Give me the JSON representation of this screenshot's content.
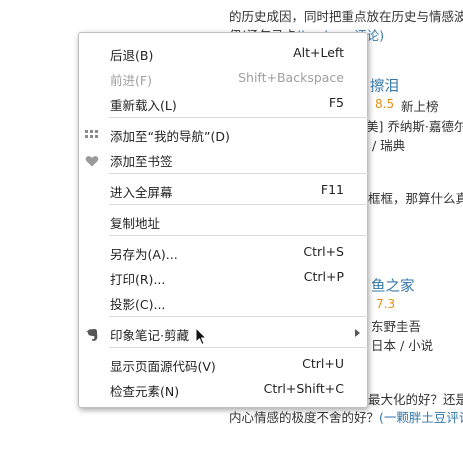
{
  "background": {
    "line1": "的历史成因，同时把重点放在历史与情感波涛",
    "line2_prefix": "伊(汤包马卡",
    "line2_link": "(bookyue评论)",
    "item1_title": "擦泪",
    "item1_rating": "8.5",
    "item1_rank": "新上榜",
    "item1_author": "美] 乔纳斯·嘉德尔",
    "item1_origin": "/ 瑞典",
    "snippet_mid": "框框，那算什么真爱",
    "item2_title": "鱼之家",
    "item2_rating": "7.3",
    "item2_author": "东野圭吾",
    "item2_origin": "日本 / 小说",
    "bottom1": "最大化的好？还是",
    "bottom2_prefix": "内心情感的极度不舍的好？",
    "bottom2_link": "(一颗胖土豆评论)"
  },
  "menu": {
    "items": [
      {
        "label": "后退(B)",
        "shortcut": "Alt+Left",
        "disabled": false
      },
      {
        "label": "前进(F)",
        "shortcut": "Shift+Backspace",
        "disabled": true
      },
      {
        "label": "重新载入(L)",
        "shortcut": "F5",
        "disabled": false
      },
      {
        "label": "添加至“我的导航”(D)",
        "shortcut": "",
        "icon": "grid-icon"
      },
      {
        "label": "添加至书签",
        "shortcut": "",
        "icon": "heart-icon"
      },
      {
        "label": "进入全屏幕",
        "shortcut": "F11"
      },
      {
        "label": "复制地址",
        "shortcut": ""
      },
      {
        "label": "另存为(A)...",
        "shortcut": "Ctrl+S"
      },
      {
        "label": "打印(R)...",
        "shortcut": "Ctrl+P"
      },
      {
        "label": "投影(C)...",
        "shortcut": ""
      },
      {
        "label": "印象笔记·剪藏",
        "shortcut": "",
        "icon": "evernote-icon",
        "submenu": true
      },
      {
        "label": "显示页面源代码(V)",
        "shortcut": "Ctrl+U"
      },
      {
        "label": "检查元素(N)",
        "shortcut": "Ctrl+Shift+C"
      }
    ]
  },
  "colors": {
    "link": "#3377aa",
    "rating": "#e09015",
    "disabled_text": "#a0a0a0"
  }
}
